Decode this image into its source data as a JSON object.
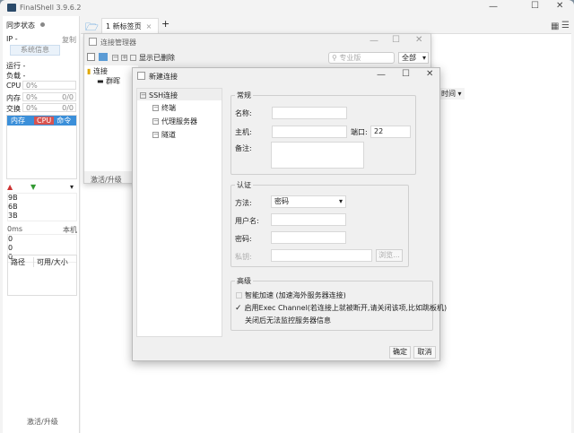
{
  "app": {
    "title": "FinalShell 3.9.6.2"
  },
  "sidebar": {
    "sync_status": "同步状态",
    "ip_label": "IP",
    "ip_value": "-",
    "copy": "复制",
    "sys_info": "系统信息",
    "run_label": "运行",
    "run_value": "-",
    "load_label": "负载",
    "load_value": "-",
    "cpu_label": "CPU",
    "cpu_value": "0%",
    "mem_label": "内存",
    "mem_value": "0%",
    "mem_ratio": "0/0",
    "swap_label": "交换",
    "swap_value": "0%",
    "swap_ratio": "0/0",
    "tabs": [
      "内存",
      "CPU",
      "命令"
    ],
    "net_values": [
      "9B",
      "6B",
      "3B"
    ],
    "ping": "0ms",
    "local": "本机",
    "ping_values": [
      "0",
      "0",
      "0"
    ],
    "disk_cols": [
      "路径",
      "可用/大小"
    ],
    "activate": "激活/升级"
  },
  "tabbar": {
    "tab_label": "1 新标签页",
    "add": "+"
  },
  "main": {
    "sort_label": "时间"
  },
  "conn_manager": {
    "title": "连接管理器",
    "show_deleted": "显示已删除",
    "search_placeholder": "专业版",
    "filter": "全部",
    "tree_root": "连接",
    "tree_child": "群晖",
    "activate": "激活/升级"
  },
  "dialog": {
    "title": "新建连接",
    "tree": [
      "SSH连接",
      "终端",
      "代理服务器",
      "隧道"
    ],
    "general": {
      "title": "常规",
      "name_label": "名称:",
      "host_label": "主机:",
      "port_label": "端口:",
      "port_value": "22",
      "note_label": "备注:"
    },
    "auth": {
      "title": "认证",
      "method_label": "方法:",
      "method_value": "密码",
      "user_label": "用户名:",
      "password_label": "密码:",
      "key_label": "私钥:",
      "browse": "浏览..."
    },
    "advanced": {
      "title": "高级",
      "smart_accel": "智能加速 (加速海外服务器连接)",
      "smart_accel_checked": false,
      "exec_channel": "启用Exec Channel(若连接上就被断开,请关闭该项,比如跳板机)",
      "exec_channel_checked": true,
      "exec_note": "关闭后无法监控服务器信息"
    },
    "ok": "确定",
    "cancel": "取消"
  }
}
